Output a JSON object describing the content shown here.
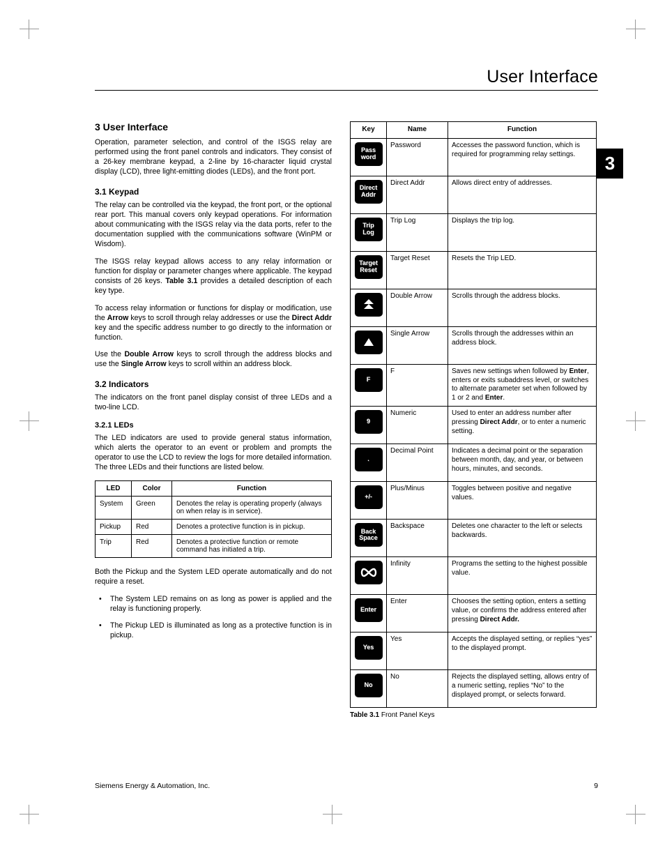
{
  "running_head": "User Interface",
  "chapter_tab": "3",
  "h1": "3   User Interface",
  "p_intro": "Operation, parameter selection, and control of the ISGS relay are performed using the front panel controls and indicators. They consist of a 26-key membrane keypad, a 2-line by 16-character liquid crystal display (LCD), three light-emitting diodes (LEDs), and the front port.",
  "h2_31": "3.1   Keypad",
  "p_31a": "The relay can be controlled via the keypad, the front port, or the optional rear port. This manual covers only keypad operations. For information about communicating with the ISGS relay via the data ports, refer to the documentation supplied with the communications software (WinPM or Wisdom).",
  "p_31b_a": "The ISGS relay keypad allows access to any relay information or function for display or parameter changes where applicable. The keypad consists of 26 keys. ",
  "p_31b_bold": "Table 3.1",
  "p_31b_b": " provides a detailed description of each key type.",
  "p_31c_a": "To access relay information or functions for display or modification, use the ",
  "p_31c_bold1": "Arrow",
  "p_31c_b": " keys to scroll through relay addresses or use the ",
  "p_31c_bold2": "Direct Addr",
  "p_31c_c": " key and the specific address number to go directly to the information or function.",
  "p_31d_a": "Use the ",
  "p_31d_bold1": "Double Arrow",
  "p_31d_b": " keys to scroll through the address blocks and use the ",
  "p_31d_bold2": "Single Arrow",
  "p_31d_c": " keys to scroll within an address block.",
  "h2_32": "3.2   Indicators",
  "p_32a": "The indicators on the front panel display consist of three LEDs and a two-line LCD.",
  "h3_321": "3.2.1    LEDs",
  "p_321a": "The LED indicators are used to provide general status information, which alerts the operator to an event or problem and prompts the operator to use the LCD to review the logs for more detailed information. The three LEDs and their functions are listed below.",
  "led_table": {
    "headers": [
      "LED",
      "Color",
      "Function"
    ],
    "rows": [
      {
        "led": "System",
        "color": "Green",
        "func": "Denotes the relay is operating properly (always on when relay is in service)."
      },
      {
        "led": "Pickup",
        "color": "Red",
        "func": "Denotes a protective function is in pickup."
      },
      {
        "led": "Trip",
        "color": "Red",
        "func": "Denotes a protective function or remote command has initiated a trip."
      }
    ]
  },
  "p_321b": "Both the Pickup and the System LED operate automatically and do not require a reset.",
  "bullets": [
    "The System LED remains on as long as power is applied and the relay is functioning properly.",
    "The Pickup LED is illuminated as long as a protective function is in pickup."
  ],
  "key_table": {
    "headers": [
      "Key",
      "Name",
      "Function"
    ],
    "rows": [
      {
        "key": "Pass\nword",
        "name": "Password",
        "func": "Accesses the password function, which is required for programming relay settings."
      },
      {
        "key": "Direct\nAddr",
        "name": "Direct Addr",
        "func": "Allows direct entry of addresses."
      },
      {
        "key": "Trip\nLog",
        "name": "Trip Log",
        "func": "Displays the trip log."
      },
      {
        "key": "Target\nReset",
        "name": "Target Reset",
        "func": "Resets the Trip LED."
      },
      {
        "key_icon": "double-arrow-up",
        "name": "Double Arrow",
        "func": "Scrolls through the address blocks."
      },
      {
        "key_icon": "single-arrow-up",
        "name": "Single Arrow",
        "func": "Scrolls through the addresses within an address block."
      },
      {
        "key": "F",
        "name": "F",
        "func_parts": [
          "Saves new settings when followed by ",
          {
            "b": "Enter"
          },
          ", enters or exits subaddress level, or switches to alternate parameter set when followed by 1 or 2 and ",
          {
            "b": "Enter"
          },
          "."
        ]
      },
      {
        "key": "9",
        "name": "Numeric",
        "func_parts": [
          "Used to enter an address number after pressing ",
          {
            "b": "Direct Addr"
          },
          ", or to enter a numeric setting."
        ]
      },
      {
        "key": ".",
        "name": "Decimal Point",
        "func": "Indicates a decimal point or the separation between month, day, and year, or between hours, minutes, and seconds."
      },
      {
        "key": "+/-",
        "name": "Plus/Minus",
        "func": "Toggles between positive and negative values."
      },
      {
        "key": "Back\nSpace",
        "name": "Backspace",
        "func": "Deletes one character to the left or selects backwards."
      },
      {
        "key_icon": "infinity",
        "name": "Infinity",
        "func": "Programs the setting to the highest possible value."
      },
      {
        "key": "Enter",
        "name": "Enter",
        "func_parts": [
          "Chooses the setting option, enters a setting value, or confirms the address entered after pressing ",
          {
            "b": "Direct Addr."
          }
        ]
      },
      {
        "key": "Yes",
        "name": "Yes",
        "func": "Accepts the displayed setting, or replies “yes” to the displayed prompt."
      },
      {
        "key": "No",
        "name": "No",
        "func": "Rejects the displayed setting, allows entry of a numeric setting, replies “No” to the displayed prompt, or selects forward."
      }
    ],
    "caption_bold": "Table 3.1",
    "caption_rest": "  Front Panel Keys"
  },
  "footer_left": "Siemens Energy & Automation, Inc.",
  "footer_right": "9"
}
